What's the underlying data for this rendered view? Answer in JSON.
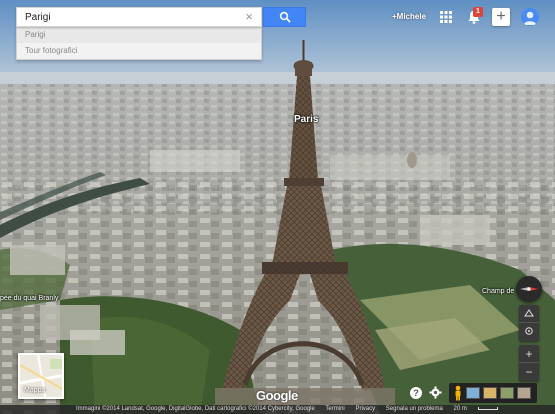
{
  "search": {
    "value": "Parigi",
    "clear_icon": "close-icon",
    "button_icon": "search-icon",
    "button_color": "#4285f4"
  },
  "suggestions": [
    {
      "label": "Parigi"
    },
    {
      "label": "Tour fotografici"
    }
  ],
  "header": {
    "user_link": "+Michele",
    "apps_icon": "apps-grid-icon",
    "notifications_icon": "bell-icon",
    "notifications_count": "1",
    "share_icon": "plus-icon",
    "share_label": "+",
    "avatar_icon": "user-avatar-icon"
  },
  "map": {
    "labels": {
      "city": "Paris",
      "quai": "pée du quai Branly",
      "champ": "Champ de"
    },
    "colors": {
      "sky": "#7ea3c9",
      "city": "#a7a9a6",
      "park": "#3f5a2e",
      "tower": "#5a4a3c"
    }
  },
  "controls": {
    "compass_icon": "compass-icon",
    "tilt_icon": "tilt-icon",
    "rotate_icon": "rotate-icon",
    "zoom_in_label": "+",
    "zoom_out_label": "−"
  },
  "minimap": {
    "label": "Mappa"
  },
  "tools": {
    "help_label": "?",
    "settings_icon": "gear-icon",
    "pegman_icon": "pegman-icon",
    "thumbnails": [
      "photo-thumb-1",
      "photo-thumb-2",
      "photo-thumb-3"
    ]
  },
  "footer": {
    "logo": "Google",
    "imagery": "Immagini ©2014 Landsat, Google, DigitalGlobe, Dati cartografici ©2014 Cybercity, Google",
    "terms": "Termini",
    "privacy": "Privacy",
    "report": "Segnala un problema",
    "scale": "20 m"
  }
}
